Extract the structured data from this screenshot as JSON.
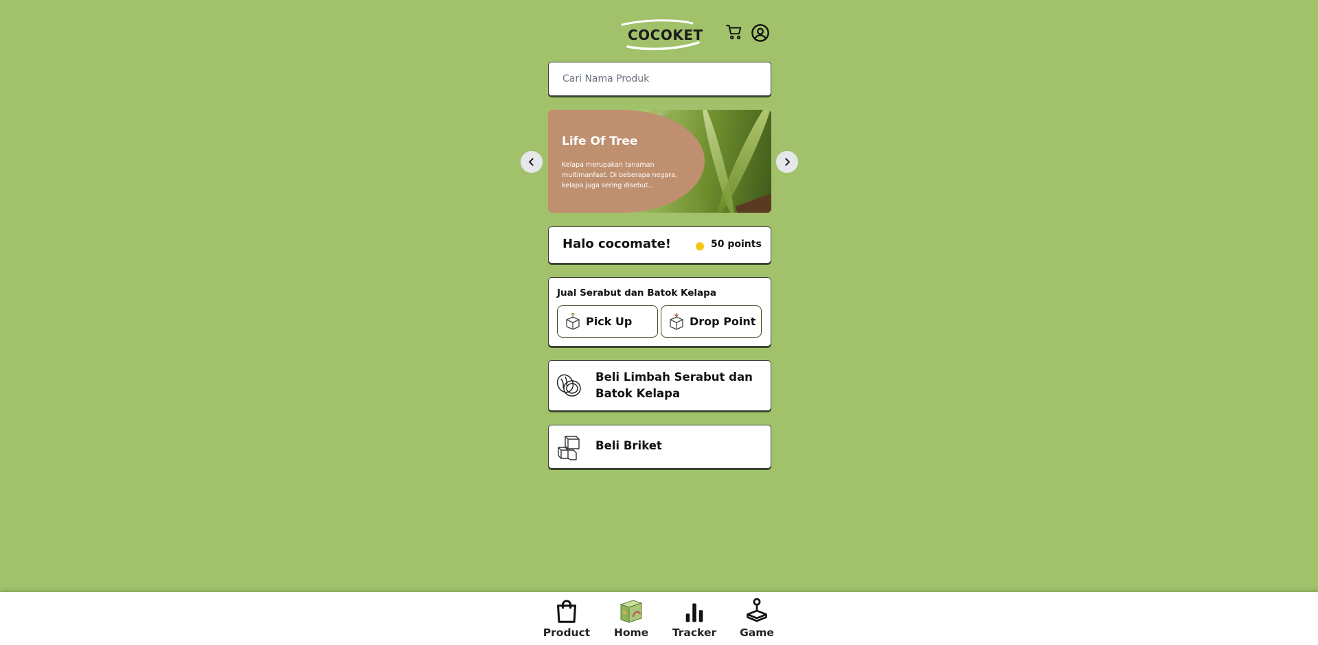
{
  "header": {
    "logo_text": "COCOKET",
    "icons": [
      "cart-icon",
      "user-account-icon"
    ]
  },
  "search": {
    "placeholder": "Cari Nama Produk"
  },
  "carousel": {
    "title": "Life Of Tree",
    "description": "Kelapa merupakan tanaman multimanfaat. Di beberapa negara, kelapa juga sering disebut...",
    "panel_color": "#bf9070"
  },
  "greeting": {
    "text": "Halo cocomate!",
    "points": "50 points",
    "coin_color": "#f5c518"
  },
  "sell": {
    "title": "Jual Serabut dan Batok Kelapa",
    "options": [
      {
        "label": "Pick Up",
        "icon": "box-pickup-icon"
      },
      {
        "label": "Drop Point",
        "icon": "box-drop-icon"
      }
    ]
  },
  "buy": [
    {
      "label": "Beli Limbah Serabut dan Batok Kelapa",
      "icon": "coconut-icon"
    },
    {
      "label": "Beli Briket",
      "icon": "briquette-icon"
    }
  ],
  "bottom_nav": [
    {
      "label": "Product",
      "icon": "shopping-bag-icon"
    },
    {
      "label": "Home",
      "icon": "home-box-icon"
    },
    {
      "label": "Tracker",
      "icon": "bar-chart-icon"
    },
    {
      "label": "Game",
      "icon": "joystick-icon"
    }
  ],
  "colors": {
    "background": "#a1c26b",
    "card": "#ffffff",
    "border": "#3d3d3d"
  }
}
